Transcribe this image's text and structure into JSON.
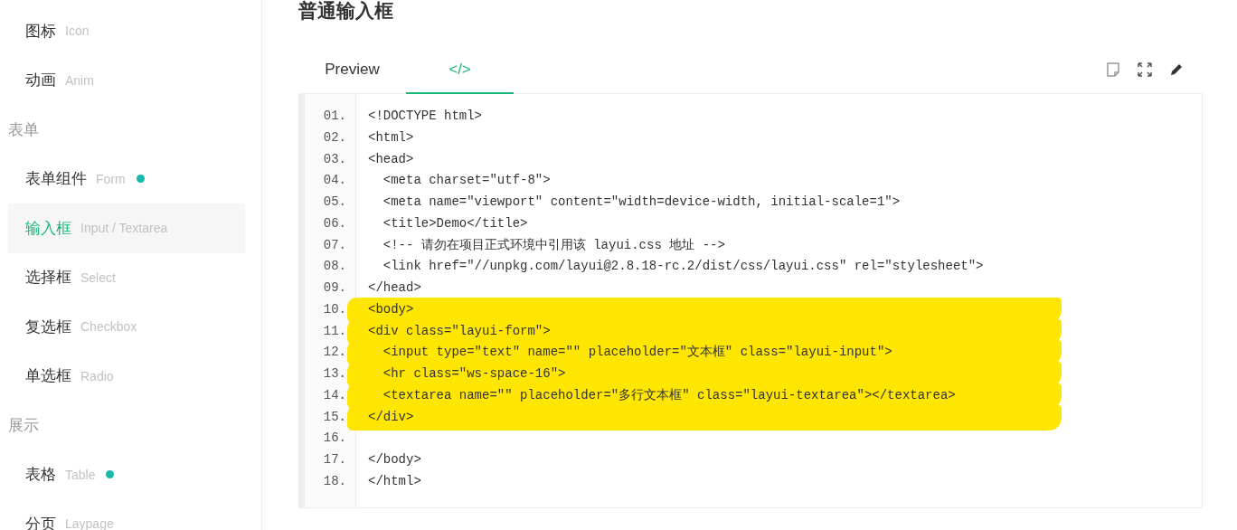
{
  "sidebar": {
    "items": [
      {
        "kind": "item",
        "label": "图标",
        "sub": "Icon",
        "dot": false,
        "selected": false
      },
      {
        "kind": "item",
        "label": "动画",
        "sub": "Anim",
        "dot": false,
        "selected": false
      },
      {
        "kind": "header",
        "label": "表单"
      },
      {
        "kind": "item",
        "label": "表单组件",
        "sub": "Form",
        "dot": true,
        "selected": false
      },
      {
        "kind": "item",
        "label": "输入框",
        "sub": "Input / Textarea",
        "dot": false,
        "selected": true
      },
      {
        "kind": "item",
        "label": "选择框",
        "sub": "Select",
        "dot": false,
        "selected": false
      },
      {
        "kind": "item",
        "label": "复选框",
        "sub": "Checkbox",
        "dot": false,
        "selected": false
      },
      {
        "kind": "item",
        "label": "单选框",
        "sub": "Radio",
        "dot": false,
        "selected": false
      },
      {
        "kind": "header",
        "label": "展示"
      },
      {
        "kind": "item",
        "label": "表格",
        "sub": "Table",
        "dot": true,
        "selected": false
      },
      {
        "kind": "item",
        "label": "分页",
        "sub": "Laypage",
        "dot": false,
        "selected": false
      }
    ]
  },
  "page_title": "普通输入框",
  "tabs": [
    {
      "label": "Preview",
      "selected": false
    },
    {
      "label": "</>",
      "selected": true
    }
  ],
  "code": {
    "lines": [
      {
        "number": "01.",
        "text": "<!DOCTYPE html>",
        "highlighted": false
      },
      {
        "number": "02.",
        "text": "<html>",
        "highlighted": false
      },
      {
        "number": "03.",
        "text": "<head>",
        "highlighted": false
      },
      {
        "number": "04.",
        "text": "  <meta charset=\"utf-8\">",
        "highlighted": false
      },
      {
        "number": "05.",
        "text": "  <meta name=\"viewport\" content=\"width=device-width, initial-scale=1\">",
        "highlighted": false
      },
      {
        "number": "06.",
        "text": "  <title>Demo</title>",
        "highlighted": false
      },
      {
        "number": "07.",
        "text": "  <!-- 请勿在项目正式环境中引用该 layui.css 地址 -->",
        "highlighted": false
      },
      {
        "number": "08.",
        "text": "  <link href=\"//unpkg.com/layui@2.8.18-rc.2/dist/css/layui.css\" rel=\"stylesheet\">",
        "highlighted": false
      },
      {
        "number": "09.",
        "text": "</head>",
        "highlighted": false
      },
      {
        "number": "10.",
        "text": "<body>",
        "highlighted": true
      },
      {
        "number": "11.",
        "text": "<div class=\"layui-form\">",
        "highlighted": true
      },
      {
        "number": "12.",
        "text": "  <input type=\"text\" name=\"\" placeholder=\"文本框\" class=\"layui-input\">",
        "highlighted": true
      },
      {
        "number": "13.",
        "text": "  <hr class=\"ws-space-16\">",
        "highlighted": true
      },
      {
        "number": "14.",
        "text": "  <textarea name=\"\" placeholder=\"多行文本框\" class=\"layui-textarea\"></textarea>",
        "highlighted": true
      },
      {
        "number": "15.",
        "text": "</div>",
        "highlighted": true
      },
      {
        "number": "16.",
        "highlighted": false
      },
      {
        "number": "17.",
        "text": "</body>",
        "highlighted": false
      },
      {
        "number": "18.",
        "text": "</html>",
        "highlighted": false
      }
    ]
  }
}
